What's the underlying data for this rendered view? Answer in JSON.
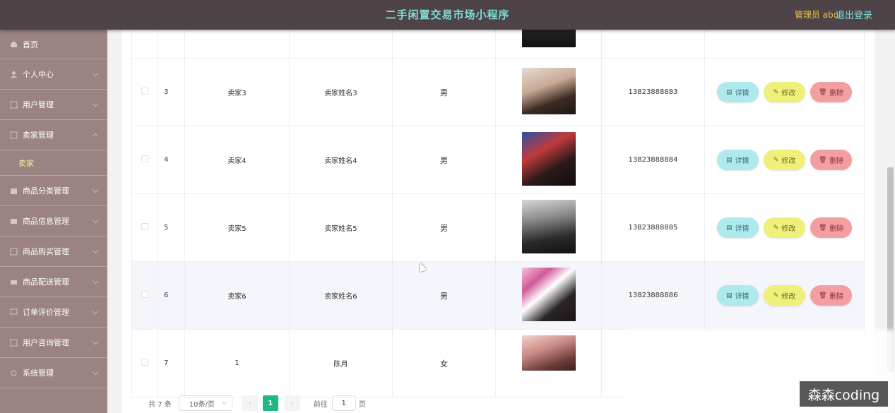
{
  "header": {
    "title": "二手闲置交易市场小程序",
    "user": "管理员 abo",
    "logout": "退出登录"
  },
  "sidebar": {
    "items": [
      {
        "label": "首页",
        "icon": "home-icon"
      },
      {
        "label": "个人中心",
        "icon": "user-icon"
      },
      {
        "label": "用户管理",
        "icon": "users-icon"
      },
      {
        "label": "卖家管理",
        "icon": "seller-icon"
      },
      {
        "label": "商品分类管理",
        "icon": "category-icon"
      },
      {
        "label": "商品信息管理",
        "icon": "goods-icon"
      },
      {
        "label": "商品购买管理",
        "icon": "cart-icon"
      },
      {
        "label": "商品配送管理",
        "icon": "truck-icon"
      },
      {
        "label": "订单评价管理",
        "icon": "comment-icon"
      },
      {
        "label": "用户咨询管理",
        "icon": "consult-icon"
      },
      {
        "label": "系统管理",
        "icon": "settings-icon"
      }
    ],
    "active_sub": "卖家"
  },
  "table": {
    "rows": [
      {
        "idx": "",
        "account": "",
        "name": "",
        "gender": "",
        "phone": ""
      },
      {
        "idx": "3",
        "account": "卖家3",
        "name": "卖家姓名3",
        "gender": "男",
        "phone": "13823888883"
      },
      {
        "idx": "4",
        "account": "卖家4",
        "name": "卖家姓名4",
        "gender": "男",
        "phone": "13823888884"
      },
      {
        "idx": "5",
        "account": "卖家5",
        "name": "卖家姓名5",
        "gender": "男",
        "phone": "13823888885"
      },
      {
        "idx": "6",
        "account": "卖家6",
        "name": "卖家姓名6",
        "gender": "男",
        "phone": "13823888886"
      },
      {
        "idx": "7",
        "account": "1",
        "name": "陈月",
        "gender": "女",
        "phone": ""
      }
    ],
    "actions": {
      "detail": "详情",
      "edit": "修改",
      "delete": "删除"
    }
  },
  "pager": {
    "total": "共 7 条",
    "page_size": "10条/页",
    "current": "1",
    "goto": "前往",
    "goto_value": "1",
    "page_unit": "页"
  },
  "watermark": "森森coding"
}
